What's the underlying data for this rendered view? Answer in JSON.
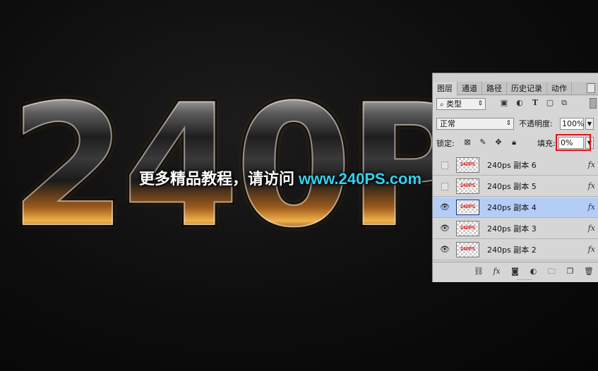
{
  "artwork": {
    "glass_text": "240P",
    "watermark_cn": "更多精品教程，请访问",
    "watermark_url": "www.240PS.com",
    "colors": {
      "url": "#2fd4f0",
      "background": "#0d0d0d",
      "highlight_orange": "#f2b24a"
    }
  },
  "panel": {
    "tabs": [
      {
        "label": "图层",
        "active": true
      },
      {
        "label": "通道",
        "active": false
      },
      {
        "label": "路径",
        "active": false
      },
      {
        "label": "历史记录",
        "active": false
      },
      {
        "label": "动作",
        "active": false
      }
    ],
    "filter": {
      "search_icon": "search-icon",
      "kind_label": "类型",
      "arrow": "⇕"
    },
    "filter_icons": [
      "image-filter-icon",
      "adjustment-filter-icon",
      "type-filter-icon",
      "shape-filter-icon",
      "smart-object-filter-icon"
    ],
    "blend_mode": "正常",
    "opacity_label": "不透明度:",
    "opacity_value": "100%",
    "lock_label": "锁定:",
    "lock_icons": [
      "lock-transparent-icon",
      "lock-image-icon",
      "lock-position-icon",
      "lock-all-icon"
    ],
    "fill_label": "填充:",
    "fill_value": "0%",
    "highlight_color": "#e0141c",
    "layers": [
      {
        "name": "240ps 副本 6",
        "visible": false,
        "selected": false,
        "thumb_text": "240PS",
        "fx": "fx"
      },
      {
        "name": "240ps 副本 5",
        "visible": false,
        "selected": false,
        "thumb_text": "240PS",
        "fx": "fx"
      },
      {
        "name": "240ps 副本 4",
        "visible": true,
        "selected": true,
        "thumb_text": "240PS",
        "fx": "fx"
      },
      {
        "name": "240ps 副本 3",
        "visible": true,
        "selected": false,
        "thumb_text": "240PS",
        "fx": "fx"
      },
      {
        "name": "240ps 副本 2",
        "visible": true,
        "selected": false,
        "thumb_text": "240PS",
        "fx": "fx"
      }
    ],
    "selected_color": "#b4cdf6",
    "bottom_icons": [
      "link-layers-icon",
      "add-style-icon",
      "add-mask-icon",
      "new-adjustment-icon",
      "new-group-icon",
      "new-layer-icon",
      "delete-icon"
    ]
  }
}
